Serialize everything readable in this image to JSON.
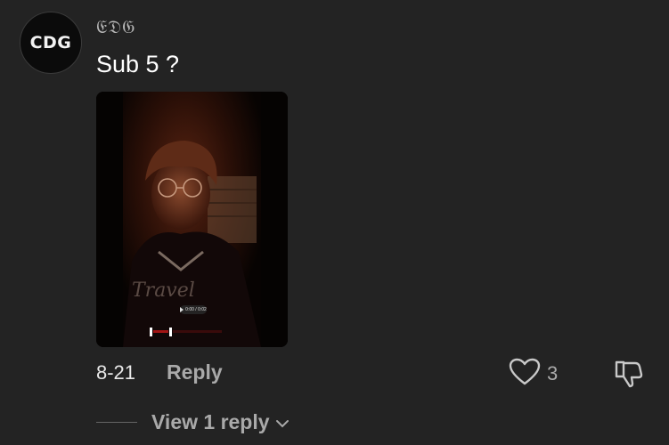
{
  "comment": {
    "avatar_text": "CDG",
    "username": "𝔈𝔇𝔊",
    "text": "Sub 5 ?",
    "date": "8-21",
    "reply_label": "Reply",
    "like_count": "3",
    "view_replies_label": "View 1 reply"
  },
  "media": {
    "video_time": "0:00 / 0:02"
  },
  "colors": {
    "background": "#232323",
    "muted_text": "#a9a9a9",
    "primary_text": "#ffffff"
  },
  "icons": {
    "like": "heart-outline-icon",
    "dislike": "thumbs-down-icon",
    "expand": "chevron-down-icon",
    "play": "play-icon"
  }
}
